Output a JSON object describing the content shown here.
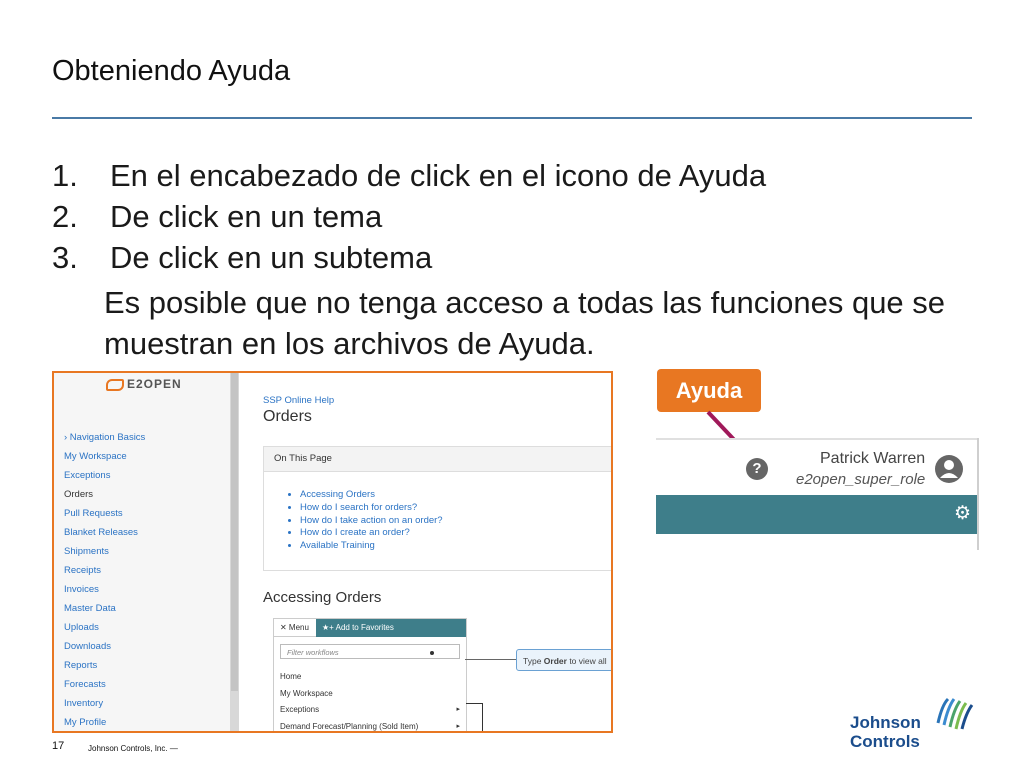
{
  "slide": {
    "title": "Obteniendo Ayuda",
    "steps": [
      {
        "num": "1.",
        "text": "En el encabezado de click en el icono de Ayuda"
      },
      {
        "num": "2.",
        "text": "De click en un tema"
      },
      {
        "num": "3.",
        "text": "De click en un subtema"
      }
    ],
    "note": "Es posible que no tenga acceso a todas las funciones que se muestran en los archivos de Ayuda.",
    "page_number": "17",
    "company_footer": "Johnson Controls, Inc. —",
    "brand_logo": "Johnson Controls",
    "accent_color": "#e87722"
  },
  "help_screenshot": {
    "logo": "E2OPEN",
    "nav": [
      {
        "label": "› Navigation Basics",
        "type": "link"
      },
      {
        "label": "My Workspace",
        "type": "link"
      },
      {
        "label": "Exceptions",
        "type": "link"
      },
      {
        "label": "Orders",
        "type": "current"
      },
      {
        "label": "Pull Requests",
        "type": "link"
      },
      {
        "label": "Blanket Releases",
        "type": "link"
      },
      {
        "label": "Shipments",
        "type": "link"
      },
      {
        "label": "Receipts",
        "type": "link"
      },
      {
        "label": "Invoices",
        "type": "link"
      },
      {
        "label": "Master Data",
        "type": "link"
      },
      {
        "label": "Uploads",
        "type": "link"
      },
      {
        "label": "Downloads",
        "type": "link"
      },
      {
        "label": "Reports",
        "type": "link"
      },
      {
        "label": "Forecasts",
        "type": "link"
      },
      {
        "label": "Inventory",
        "type": "link"
      },
      {
        "label": "My Profile",
        "type": "link"
      }
    ],
    "breadcrumb": "SSP Online Help",
    "page_title": "Orders",
    "on_this_page": {
      "heading": "On This Page",
      "links": [
        "Accessing Orders",
        "How do I search for orders?",
        "How do I take action on an order?",
        "How do I create an order?",
        "Available Training"
      ]
    },
    "section_title": "Accessing Orders",
    "mini_menu": {
      "menu_label": "✕ Menu",
      "favorites_label": "★+ Add to Favorites",
      "filter_placeholder": "Filter workflows",
      "items": [
        {
          "label": "Home",
          "arrow": ""
        },
        {
          "label": "My Workspace",
          "arrow": ""
        },
        {
          "label": "Exceptions",
          "arrow": "▸"
        },
        {
          "label": "Demand Forecast/Planning (Sold Item)",
          "arrow": "▸"
        }
      ],
      "tooltip_prefix": "Type ",
      "tooltip_bold": "Order",
      "tooltip_suffix": " to view all"
    }
  },
  "header_screenshot": {
    "badge_label": "Ayuda",
    "help_icon": "?",
    "user_name": "Patrick Warren",
    "user_role": "e2open_super_role",
    "gear_icon": "⚙",
    "bar_color": "#3e7e8a"
  }
}
